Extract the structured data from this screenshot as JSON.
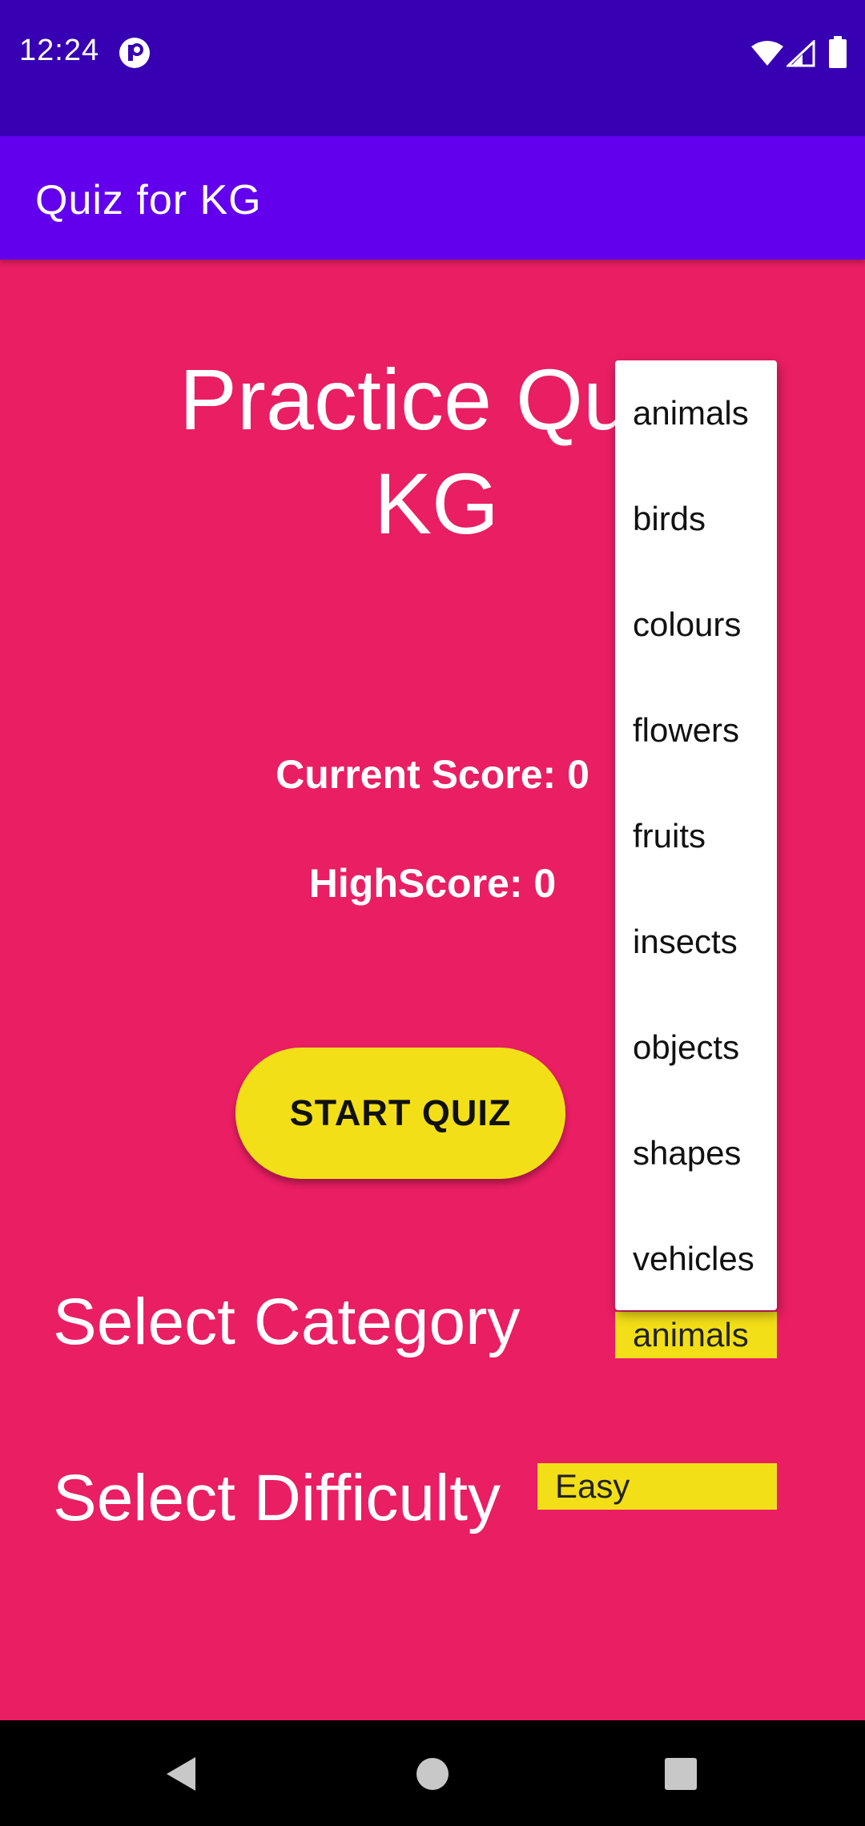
{
  "status_bar": {
    "time": "12:24"
  },
  "app_bar": {
    "title": "Quiz for KG"
  },
  "main": {
    "title_line1": "Practice Quiz",
    "title_line2": "KG",
    "current_score": "Current Score: 0",
    "high_score": "HighScore: 0",
    "start_button": "START QUIZ",
    "category_label": "Select Category",
    "difficulty_label": "Select Difficulty",
    "category_selected": "animals",
    "difficulty_selected": "Easy"
  },
  "category_dropdown": {
    "options": [
      "animals",
      "birds",
      "colours",
      "flowers",
      "fruits",
      "insects",
      "objects",
      "shapes",
      "vehicles"
    ]
  },
  "colors": {
    "status_bar": "#3700B3",
    "app_bar": "#6200EE",
    "background": "#E91E63",
    "accent_yellow": "#F2DF17"
  },
  "icons": {
    "status_app": "app-notification-icon",
    "wifi": "wifi-icon",
    "signal": "cell-signal-icon",
    "battery": "battery-icon",
    "nav_back": "back-icon",
    "nav_home": "home-icon",
    "nav_recents": "recents-icon"
  }
}
